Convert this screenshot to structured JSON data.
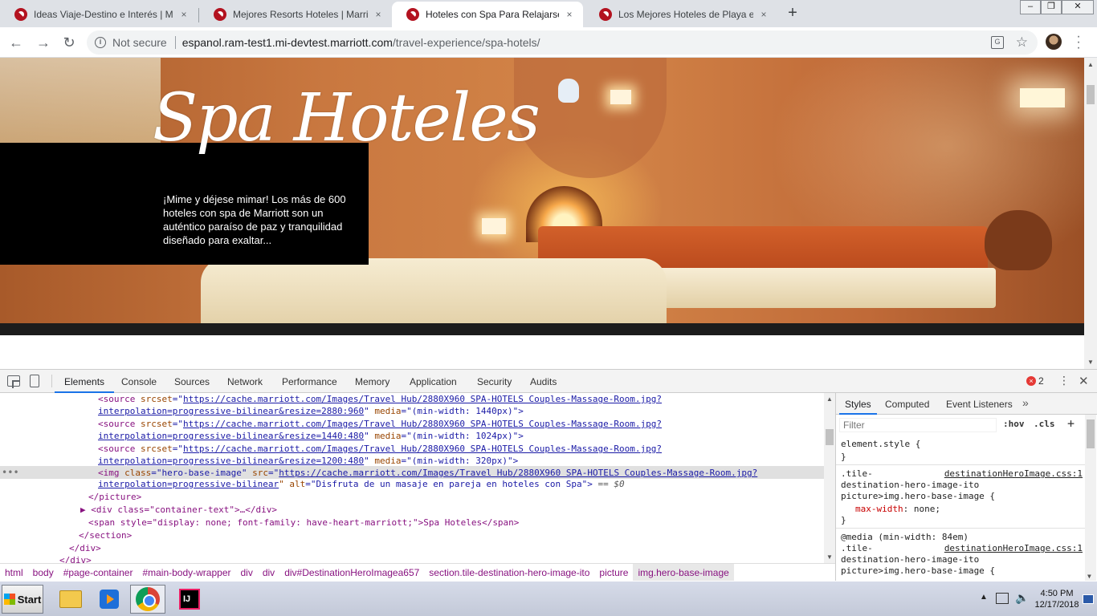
{
  "browser": {
    "tabs": [
      {
        "label": "Ideas Viaje-Destino e Interés | Marri",
        "close": "×"
      },
      {
        "label": "Mejores Resorts Hoteles | Marriott In",
        "close": "×"
      },
      {
        "label": "Hoteles con Spa Para Relajarse | Mar",
        "close": "×"
      },
      {
        "label": "Los Mejores Hoteles de Playa en el M",
        "close": "×"
      }
    ],
    "new_tab": "+",
    "window_controls": {
      "minimize": "–",
      "restore": "❐",
      "close": "✕"
    },
    "toolbar": {
      "back": "←",
      "forward": "→",
      "reload": "↻"
    },
    "omnibox": {
      "security_label": "Not secure",
      "url_host": "espanol.ram-test1.mi-devtest.marriott.com",
      "url_path": "/travel-experience/spa-hotels/"
    }
  },
  "page": {
    "hero_title": "Spa Hoteles",
    "hero_description": "¡Mime y déjese mimar! Los más de 600 hoteles con spa de Marriott son un auténtico paraíso de paz y tranquilidad diseñado para exaltar..."
  },
  "devtools": {
    "tabs": [
      "Elements",
      "Console",
      "Sources",
      "Network",
      "Performance",
      "Memory",
      "Application",
      "Security",
      "Audits"
    ],
    "active_tab": "Elements",
    "error_count": "2",
    "error_badge": "×",
    "code_lines": [
      {
        "tag_open": "<source ",
        "attr1": "srcset",
        "eq1": "=\"",
        "link": "https://cache.marriott.com/Images/Travel Hub/2880X960 SPA-HOTELS Couples-Massage-Room.jpg?",
        "close1": "\""
      },
      {
        "cont": "interpolation=progressive-bilinear&resize=2880:960",
        "attr2": " media",
        "val2": "=\"(min-width: 1440px)\">"
      },
      {
        "tag_open": "<source ",
        "attr1": "srcset",
        "eq1": "=\"",
        "link": "https://cache.marriott.com/Images/Travel Hub/2880X960 SPA-HOTELS Couples-Massage-Room.jpg?",
        "close1": "\""
      },
      {
        "cont": "interpolation=progressive-bilinear&resize=1440:480",
        "attr2": " media",
        "val2": "=\"(min-width: 1024px)\">"
      },
      {
        "tag_open": "<source ",
        "attr1": "srcset",
        "eq1": "=\"",
        "link": "https://cache.marriott.com/Images/Travel Hub/2880X960 SPA-HOTELS Couples-Massage-Room.jpg?",
        "close1": "\""
      },
      {
        "cont": "interpolation=progressive-bilinear&resize=1200:480",
        "attr2": " media",
        "val2": "=\"(min-width: 320px)\">"
      },
      {
        "tag_open": "<img ",
        "attr1": "class",
        "val1": "=\"hero-base-image\" ",
        "attr1b": "src",
        "eq1": "=\"",
        "link": "https://cache.marriott.com/Images/Travel Hub/2880X960 SPA-HOTELS Couples-Massage-Room.jpg?",
        "close1": "\""
      },
      {
        "cont": "interpolation=progressive-bilinear",
        "attr2": "\" alt",
        "val2": "=\"Disfruta de un masaje en pareja en hoteles con Spa\">",
        "extra": " == $0"
      },
      {
        "text": "</picture>"
      },
      {
        "text": "▶ <div class=\"container-text\">…</div>"
      },
      {
        "text": "<span style=\"display: none; font-family: have-heart-marriott;\">Spa Hoteles</span>"
      },
      {
        "text": "</section>"
      },
      {
        "text": "</div>"
      },
      {
        "text": "</div>"
      }
    ],
    "row_menu": "•••",
    "breadcrumbs": [
      "html",
      "body",
      "#page-container",
      "#main-body-wrapper",
      "div",
      "div",
      "div#DestinationHeroImagea657",
      "section.tile-destination-hero-image-ito",
      "picture",
      "img.hero-base-image"
    ],
    "styles_pane": {
      "tabs": [
        "Styles",
        "Computed",
        "Event Listeners"
      ],
      "more": "»",
      "filter_placeholder": "Filter",
      "hov": ":hov",
      "cls": ".cls",
      "plus": "+",
      "rules": {
        "element_style_open": "element.style {",
        "element_style_close": "}",
        "rule1_sel1": ".tile-",
        "rule1_src": "destinationHeroImage.css:1",
        "rule1_sel2": "destination-hero-image-ito",
        "rule1_sel3": "picture>img.hero-base-image {",
        "rule1_prop": "max-width",
        "rule1_val": ": none;",
        "rule1_close": "}",
        "media": "@media (min-width: 84em)",
        "rule2_sel1": ".tile-",
        "rule2_src": "destinationHeroImage.css:1",
        "rule2_sel2": "destination-hero-image-ito",
        "rule2_sel3": "picture>img.hero-base-image {"
      }
    }
  },
  "taskbar": {
    "start": "Start",
    "clock_time": "4:50 PM",
    "clock_date": "12/17/2018",
    "ij_label": "IJ"
  },
  "colors": {
    "marriott_red": "#b3121f",
    "devtools_accent": "#1a73e8",
    "error_red": "#e53935"
  }
}
